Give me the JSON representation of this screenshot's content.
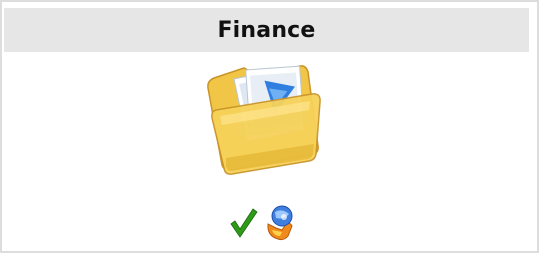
{
  "tile": {
    "title": "Finance",
    "folder_icon": "folder-with-documents-icon",
    "status_icons": [
      "checkmark-icon",
      "utility-gear-icon"
    ]
  },
  "colors": {
    "header_bg": "#e6e6e6",
    "border": "#dddddd",
    "folder_yellow": "#f5c842",
    "check_green": "#2e9a18"
  }
}
